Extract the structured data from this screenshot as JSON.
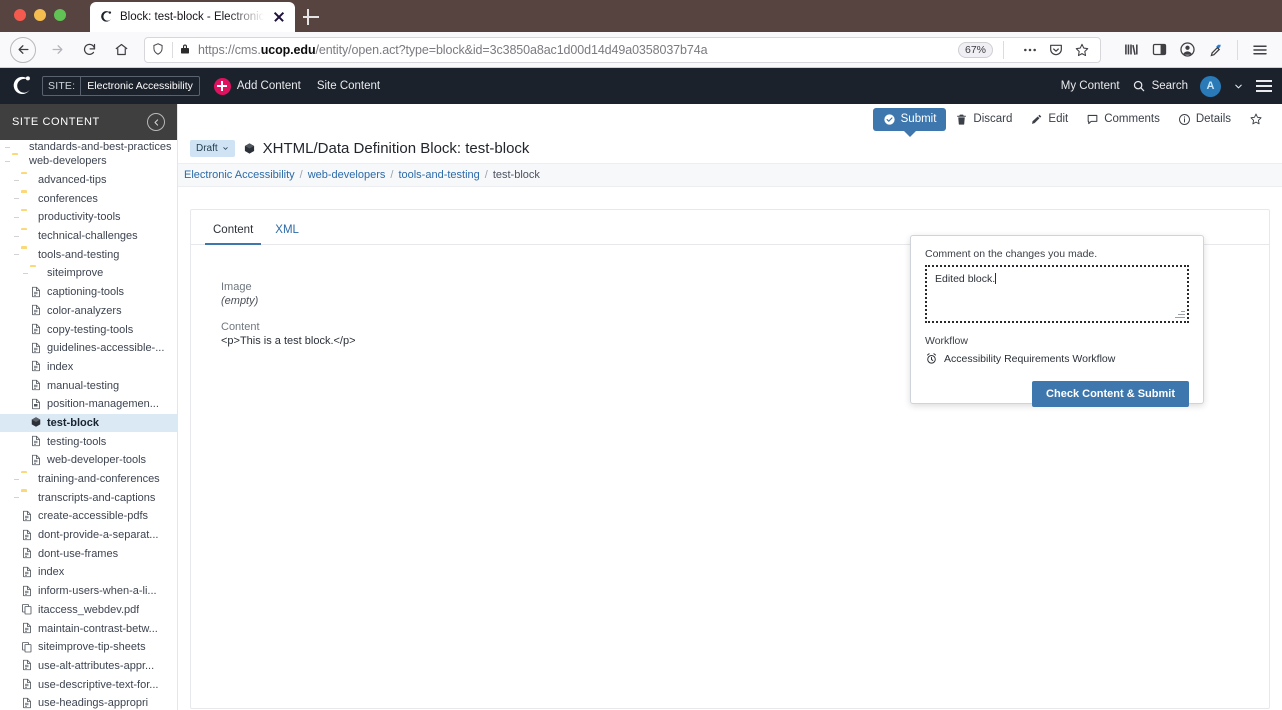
{
  "browser": {
    "tab": {
      "title": "Block: test-block - Electronic A",
      "favicon_name": "cascade-favicon"
    },
    "url": {
      "scheme": "https://cms.",
      "host": "ucop.edu",
      "path": "/entity/open.act?type=block&id=3c3850a8ac1d00d14d49a0358037b74a"
    },
    "zoom": "67%",
    "controls": {
      "back": "back-arrow",
      "forward": "forward-arrow",
      "reload": "reload",
      "home": "home",
      "shield": "tracking-protection",
      "lock": "site-lock",
      "page_actions": "ellipsis",
      "pocket": "save-to-pocket",
      "bookmark": "star",
      "library": "library",
      "sidebars": "sidebar-toggle",
      "account": "account",
      "eyedropper": "eyedropper",
      "menu": "app-menu",
      "newtab": "new-tab"
    }
  },
  "app_header": {
    "logo": "cascade-logo",
    "site_key": "SITE:",
    "site_name": "Electronic Accessibility",
    "add_content": "Add Content",
    "site_content": "Site Content",
    "my_content": "My Content",
    "search": "Search",
    "avatar_initial": "A"
  },
  "sidebar": {
    "heading": "SITE CONTENT",
    "items": [
      {
        "label": "standards-and-best-practices",
        "type": "folder",
        "depth": 1,
        "clipped": true
      },
      {
        "label": "web-developers",
        "type": "folder",
        "depth": 1
      },
      {
        "label": "advanced-tips",
        "type": "folder",
        "depth": 2
      },
      {
        "label": "conferences",
        "type": "folder",
        "depth": 2
      },
      {
        "label": "productivity-tools",
        "type": "folder",
        "depth": 2
      },
      {
        "label": "technical-challenges",
        "type": "folder",
        "depth": 2
      },
      {
        "label": "tools-and-testing",
        "type": "folder",
        "depth": 2
      },
      {
        "label": "siteimprove",
        "type": "folder",
        "depth": 3
      },
      {
        "label": "captioning-tools",
        "type": "page",
        "depth": 3
      },
      {
        "label": "color-analyzers",
        "type": "page",
        "depth": 3
      },
      {
        "label": "copy-testing-tools",
        "type": "page",
        "depth": 3
      },
      {
        "label": "guidelines-accessible-...",
        "type": "page",
        "depth": 3
      },
      {
        "label": "index",
        "type": "page",
        "depth": 3
      },
      {
        "label": "manual-testing",
        "type": "page",
        "depth": 3
      },
      {
        "label": "position-managemen...",
        "type": "page-alt",
        "depth": 3
      },
      {
        "label": "test-block",
        "type": "block",
        "depth": 3,
        "selected": true
      },
      {
        "label": "testing-tools",
        "type": "page",
        "depth": 3
      },
      {
        "label": "web-developer-tools",
        "type": "page",
        "depth": 3
      },
      {
        "label": "training-and-conferences",
        "type": "folder",
        "depth": 2
      },
      {
        "label": "transcripts-and-captions",
        "type": "folder",
        "depth": 2
      },
      {
        "label": "create-accessible-pdfs",
        "type": "page",
        "depth": 2
      },
      {
        "label": "dont-provide-a-separat...",
        "type": "page",
        "depth": 2
      },
      {
        "label": "dont-use-frames",
        "type": "page",
        "depth": 2
      },
      {
        "label": "index",
        "type": "page",
        "depth": 2
      },
      {
        "label": "inform-users-when-a-li...",
        "type": "page",
        "depth": 2
      },
      {
        "label": "itaccess_webdev.pdf",
        "type": "file",
        "depth": 2
      },
      {
        "label": "maintain-contrast-betw...",
        "type": "page",
        "depth": 2
      },
      {
        "label": "siteimprove-tip-sheets",
        "type": "file",
        "depth": 2
      },
      {
        "label": "use-alt-attributes-appr...",
        "type": "page",
        "depth": 2
      },
      {
        "label": "use-descriptive-text-for...",
        "type": "page",
        "depth": 2
      },
      {
        "label": "use-headings-appropri",
        "type": "page",
        "depth": 2
      }
    ]
  },
  "actions": [
    {
      "label": "Submit",
      "icon": "check-circle-icon",
      "primary": true
    },
    {
      "label": "Discard",
      "icon": "trash-icon"
    },
    {
      "label": "Edit",
      "icon": "pencil-icon"
    },
    {
      "label": "Comments",
      "icon": "comment-icon"
    },
    {
      "label": "Details",
      "icon": "info-icon"
    }
  ],
  "star_action": "star-icon",
  "page": {
    "draft_badge": "Draft",
    "title": "XHTML/Data Definition Block: test-block",
    "title_icon": "block-icon",
    "breadcrumb": [
      {
        "label": "Electronic Accessibility",
        "link": true
      },
      {
        "label": "web-developers",
        "link": true
      },
      {
        "label": "tools-and-testing",
        "link": true
      },
      {
        "label": "test-block",
        "link": false
      }
    ],
    "tabs": [
      {
        "label": "Content",
        "active": true
      },
      {
        "label": "XML",
        "active": false
      }
    ],
    "fields": [
      {
        "label": "Image",
        "value": "(empty)",
        "empty": true
      },
      {
        "label": "Content",
        "value": "<p>This is a test block.</p>",
        "empty": false
      }
    ]
  },
  "submit_popup": {
    "comment_label": "Comment on the changes you made.",
    "comment_value": "Edited block.",
    "workflow_label": "Workflow",
    "workflow_icon": "alarm-clock-icon",
    "workflow_name": "Accessibility Requirements Workflow",
    "button_label": "Check Content & Submit"
  },
  "colors": {
    "accent_blue": "#3d77ad",
    "header_dark": "#1c222c",
    "sidebar_head": "#3f3f3f",
    "pink": "#e0115f",
    "folder_yellow": "#fbd97a",
    "selected_row": "#dbe9f5",
    "scrollbar_blue": "#1a7fd4"
  }
}
